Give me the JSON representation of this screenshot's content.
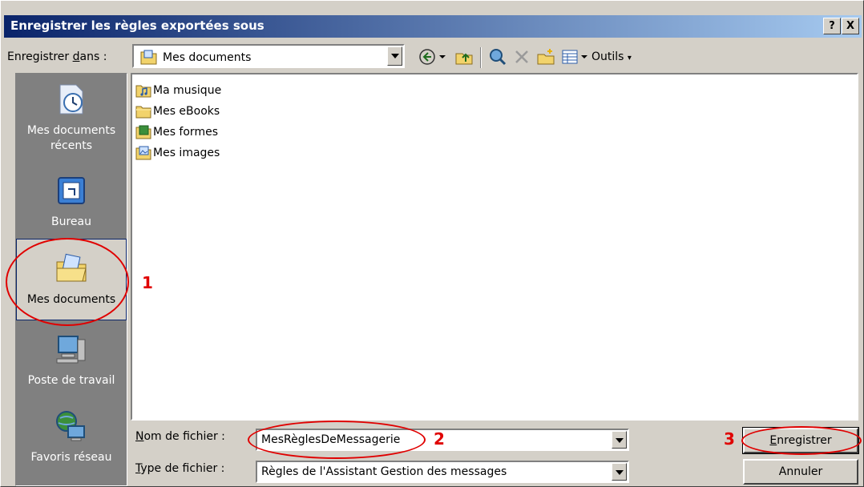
{
  "dialog": {
    "title": "Enregistrer les règles exportées sous",
    "help_label": "?",
    "close_label": "X"
  },
  "save_in": {
    "label_prefix": "Enregistrer ",
    "label_underlined": "d",
    "label_suffix": "ans :",
    "value": "Mes documents"
  },
  "toolbar": {
    "tools_label": "Outils"
  },
  "places": [
    {
      "label_line1": "Mes documents",
      "label_line2": "récents",
      "icon": "recent-documents-icon"
    },
    {
      "label_line1": "Bureau",
      "label_line2": "",
      "icon": "desktop-icon"
    },
    {
      "label_line1": "Mes documents",
      "label_line2": "",
      "icon": "my-documents-icon",
      "selected": true
    },
    {
      "label_line1": "Poste de travail",
      "label_line2": "",
      "icon": "my-computer-icon"
    },
    {
      "label_line1": "Favoris réseau",
      "label_line2": "",
      "icon": "network-places-icon"
    }
  ],
  "files": [
    {
      "name": "Ma musique",
      "icon": "music-folder-icon"
    },
    {
      "name": "Mes eBooks",
      "icon": "folder-icon"
    },
    {
      "name": "Mes formes",
      "icon": "shapes-folder-icon"
    },
    {
      "name": "Mes images",
      "icon": "pictures-folder-icon"
    }
  ],
  "filename": {
    "label_underlined": "N",
    "label_rest": "om de fichier :",
    "value": "MesRèglesDeMessagerie"
  },
  "filetype": {
    "label_underlined": "T",
    "label_rest": "ype de fichier :",
    "value": "Règles de l'Assistant Gestion des messages"
  },
  "buttons": {
    "save_underlined": "E",
    "save_rest": "nregistrer",
    "cancel": "Annuler"
  },
  "annotations": {
    "n1": "1",
    "n2": "2",
    "n3": "3",
    "color": "#e00000"
  }
}
